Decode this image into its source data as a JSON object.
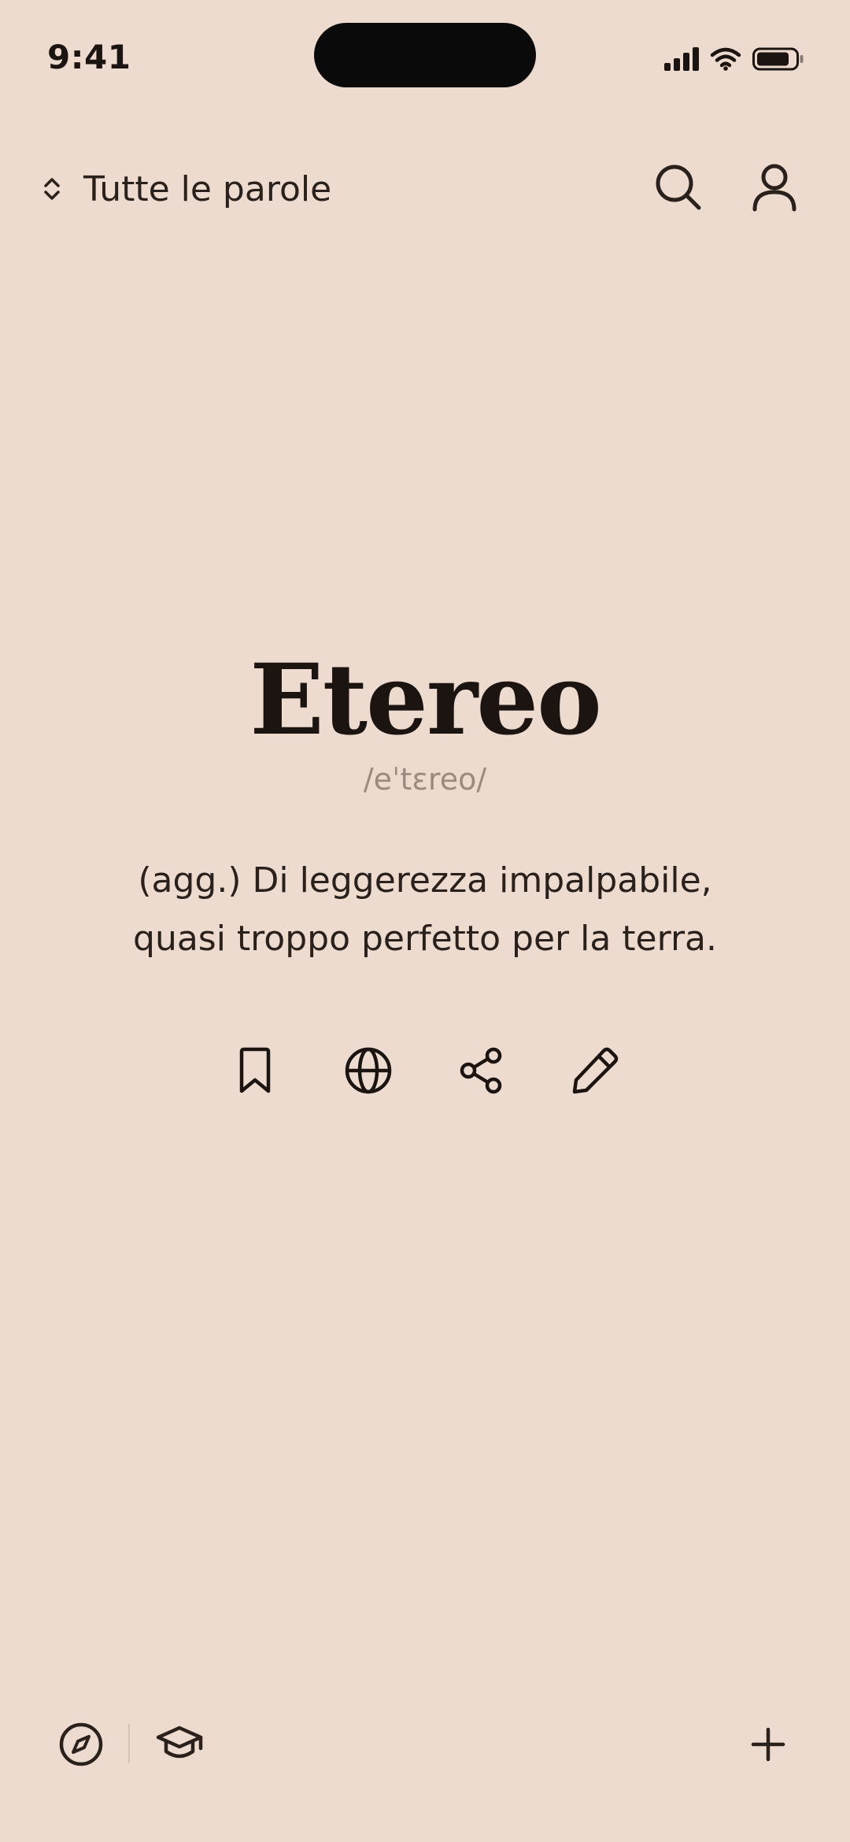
{
  "status_bar": {
    "time": "9:41"
  },
  "header": {
    "filter_label": "Tutte le parole",
    "icons": {
      "filter": "chevron-up-down-icon",
      "search": "search-icon",
      "profile": "user-icon"
    }
  },
  "word": {
    "title": "Etereo",
    "pronunciation": "/eˈtɛreo/",
    "definition": "(agg.) Di leggerezza impalpabile, quasi troppo perfetto per la terra."
  },
  "actions": [
    {
      "icon": "bookmark-icon"
    },
    {
      "icon": "globe-icon"
    },
    {
      "icon": "share-icon"
    },
    {
      "icon": "pencil-icon"
    }
  ],
  "bottom_bar": {
    "icons": [
      "compass-icon",
      "graduation-cap-icon",
      "plus-icon"
    ]
  },
  "colors": {
    "background": "#EEDBCF",
    "text_primary": "#1C1410",
    "text_secondary": "#9A8A80"
  }
}
